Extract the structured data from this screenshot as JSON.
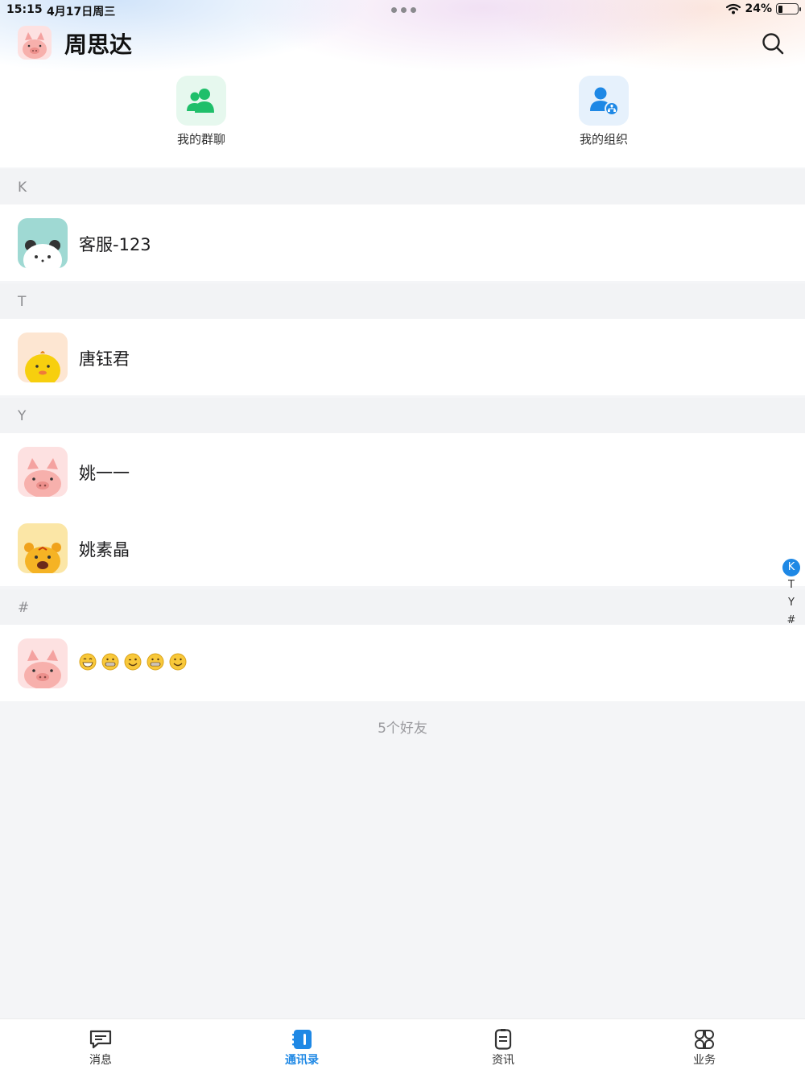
{
  "status_bar": {
    "time": "15:15",
    "date": "4月17日周三",
    "battery": "24%",
    "battery_level": 0.24
  },
  "header": {
    "title": "周思达",
    "avatar_icon": "pig-avatar-icon",
    "search_icon": "search-icon"
  },
  "shortcuts": [
    {
      "label": "我的群聊",
      "icon": "group-chat-icon",
      "color": "#1fbf6a"
    },
    {
      "label": "我的组织",
      "icon": "organization-icon",
      "color": "#1e88e5"
    }
  ],
  "sections": [
    {
      "letter": "K",
      "contacts": [
        {
          "name": "客服-123",
          "avatar": "panda-avatar-icon"
        }
      ]
    },
    {
      "letter": "T",
      "contacts": [
        {
          "name": "唐钰君",
          "avatar": "chick-avatar-icon"
        }
      ]
    },
    {
      "letter": "Y",
      "contacts": [
        {
          "name": "姚一一",
          "avatar": "pig-avatar-icon"
        },
        {
          "name": "姚素晶",
          "avatar": "tiger-avatar-icon"
        }
      ]
    },
    {
      "letter": "#",
      "contacts": [
        {
          "name": "",
          "emoji_name": [
            "grin-emoji-icon",
            "grimace-emoji-icon",
            "wink-emoji-icon",
            "grimace-emoji-icon",
            "smile-emoji-icon"
          ],
          "avatar": "pig-avatar-icon"
        }
      ]
    }
  ],
  "index_bar": [
    "K",
    "T",
    "Y",
    "#"
  ],
  "index_active": "K",
  "friend_count": "5个好友",
  "tabs": [
    {
      "label": "消息",
      "icon": "message-icon",
      "active": false
    },
    {
      "label": "通讯录",
      "icon": "contacts-icon",
      "active": true
    },
    {
      "label": "资讯",
      "icon": "news-icon",
      "active": false
    },
    {
      "label": "业务",
      "icon": "business-icon",
      "active": false
    }
  ],
  "colors": {
    "accent": "#1e88e5",
    "group_green": "#1fbf6a"
  }
}
